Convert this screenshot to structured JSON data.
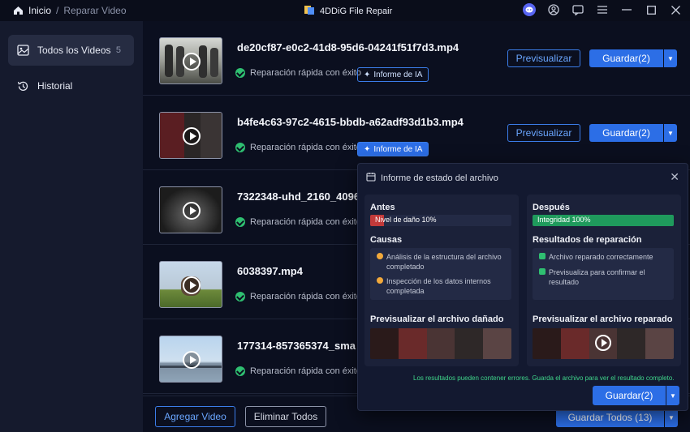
{
  "titlebar": {
    "breadcrumb_home": "Inicio",
    "breadcrumb_sep": "/",
    "breadcrumb_current": "Reparar Video",
    "app_title": "4DDiG File Repair"
  },
  "sidebar": {
    "items": [
      {
        "label": "Todos los Videos",
        "count": "5",
        "icon": "image-icon"
      },
      {
        "label": "Historial",
        "icon": "history-icon"
      }
    ]
  },
  "videos": [
    {
      "name": "de20cf87-e0c2-41d8-95d6-04241f51f7d3.mp4",
      "status": "Reparación rápida con éxito",
      "ai_label": "Informe de IA",
      "preview": "Previsualizar",
      "save": "Guardar(2)"
    },
    {
      "name": "b4fe4c63-97c2-4615-bbdb-a62adf93d1b3.mp4",
      "status": "Reparación rápida con éxito",
      "ai_label": "Informe de IA",
      "preview": "Previsualizar",
      "save": "Guardar(2)"
    },
    {
      "name": "7322348-uhd_2160_4096",
      "status": "Reparación rápida con éxito"
    },
    {
      "name": "6038397.mp4",
      "status": "Reparación rápida con éxito"
    },
    {
      "name": "177314-857365374_sma",
      "status": "Reparación rápida con éxito"
    }
  ],
  "bottom": {
    "add_label": "Agregar Video",
    "delete_label": "Eliminar Todos",
    "save_all_label": "Guardar Todos (13)"
  },
  "popup": {
    "title": "Informe de estado del archivo",
    "before": {
      "heading": "Antes",
      "meter_label": "Nivel de daño 10%",
      "damage_level": 0.1,
      "causes_heading": "Causas",
      "causes": [
        "Análisis de la estructura del archivo completado",
        "Inspección de los datos internos completada"
      ],
      "preview_heading": "Previsualizar el archivo dañado"
    },
    "after": {
      "heading": "Después",
      "meter_label": "Integridad 100%",
      "integrity_level": 1.0,
      "results_heading": "Resultados de reparación",
      "results": [
        "Archivo reparado correctamente",
        "Previsualiza para confirmar el resultado"
      ],
      "preview_heading": "Previsualizar el archivo reparado"
    },
    "note": "Los resultados pueden contener errores. Guarda el archivo para ver el resultado completo.",
    "save_label": "Guardar(2)"
  },
  "colors": {
    "accent": "#2c6ee6",
    "success": "#2fbf71",
    "damage": "#c23a3a",
    "integrity": "#1f9a5c"
  }
}
